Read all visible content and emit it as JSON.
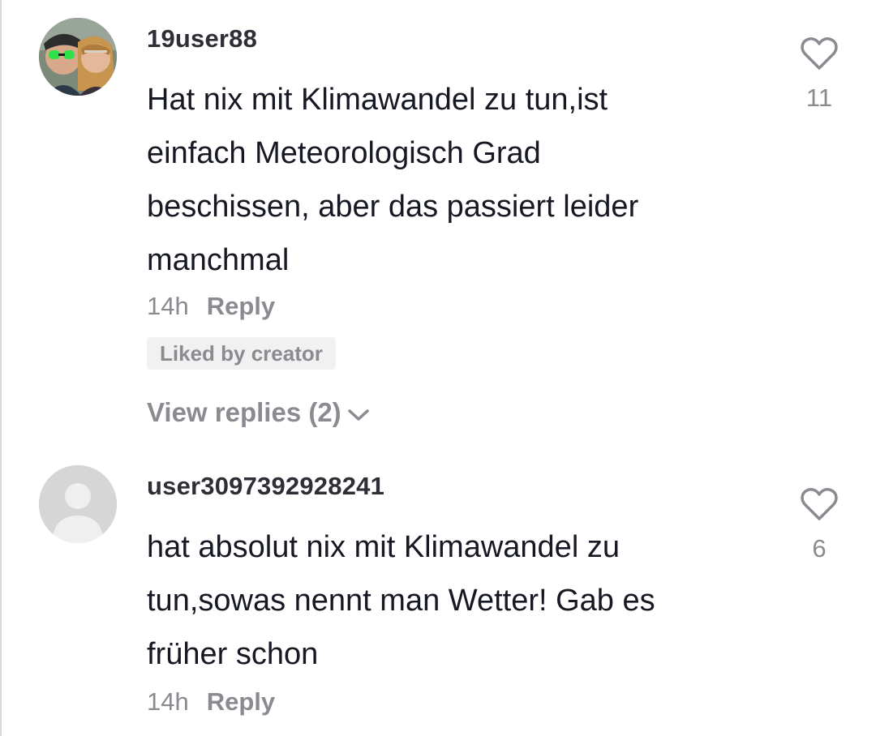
{
  "comments": [
    {
      "username": "19user88",
      "lines": [
        "Hat nix mit Klimawandel zu tun,ist",
        "einfach Meteorologisch Grad",
        "beschissen, aber das passiert leider",
        "manchmal"
      ],
      "time": "14h",
      "reply_label": "Reply",
      "liked_badge": "Liked by creator",
      "view_replies": "View replies (2)",
      "like_count": "11",
      "avatar": "profile-photo"
    },
    {
      "username": "user3097392928241",
      "lines": [
        "hat absolut nix mit Klimawandel zu",
        "tun,sowas nennt man Wetter! Gab es",
        "früher schon"
      ],
      "time": "14h",
      "reply_label": "Reply",
      "like_count": "6",
      "avatar": "default-avatar"
    }
  ],
  "icons": {
    "like": "heart-outline-icon",
    "expand": "chevron-down-icon"
  },
  "colors": {
    "text_primary": "#161823",
    "text_secondary": "#8a8b91",
    "badge_bg": "#f1f1f2"
  }
}
